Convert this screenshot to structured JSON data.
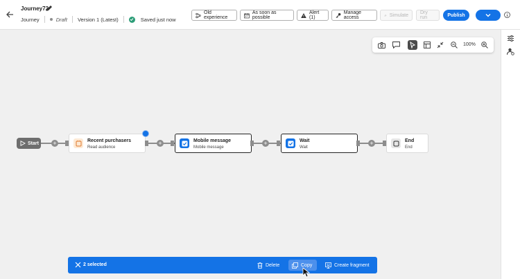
{
  "header": {
    "title": "Journey72",
    "type": "Journey",
    "status": "Draft",
    "version": "Version 1 (Latest)",
    "save_status": "Saved just now",
    "buttons": {
      "old_experience": "Old experience",
      "schedule": "As soon as possible",
      "alert": "Alert (1)",
      "manage_access": "Manage access",
      "simulate": "Simulate",
      "dry_run": "Dry run",
      "publish": "Publish"
    }
  },
  "toolbar": {
    "zoom": "100%"
  },
  "canvas": {
    "start_label": "Start",
    "nodes": [
      {
        "name": "Recent purchasers",
        "subtitle": "Read audience"
      },
      {
        "name": "Mobile message",
        "subtitle": "Mobile message"
      },
      {
        "name": "Wait",
        "subtitle": "Wait"
      },
      {
        "name": "End",
        "subtitle": "End"
      }
    ],
    "plus_symbol": "+"
  },
  "action_bar": {
    "selected": "2 selected",
    "delete": "Delete",
    "copy": "Copy",
    "create_fragment": "Create fragment"
  },
  "colors": {
    "accent": "#1473e6",
    "success": "#2d9d78",
    "audience_icon_bg": "#fde9d4",
    "message_icon_bg": "#1473e6",
    "wait_icon_bg": "#1473e6",
    "end_icon_bg": "#e6e6e6"
  }
}
